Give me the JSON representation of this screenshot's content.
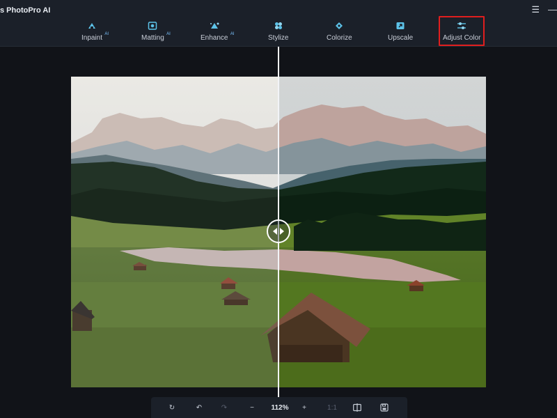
{
  "app": {
    "title": "s PhotoPro AI"
  },
  "window_controls": {
    "menu": "☰",
    "minimize": "—"
  },
  "toolbar": {
    "tools": [
      {
        "label": "Inpaint",
        "ai": "AI",
        "icon": "inpaint-icon"
      },
      {
        "label": "Matting",
        "ai": "AI",
        "icon": "matting-icon"
      },
      {
        "label": "Enhance",
        "ai": "AI",
        "icon": "enhance-icon"
      },
      {
        "label": "Stylize",
        "icon": "stylize-icon"
      },
      {
        "label": "Colorize",
        "icon": "colorize-icon"
      },
      {
        "label": "Upscale",
        "icon": "upscale-icon"
      },
      {
        "label": "Adjust Color",
        "icon": "adjust-color-icon",
        "active": true
      }
    ]
  },
  "comparison": {
    "handle_icon": "compare-handle-icon"
  },
  "bottom": {
    "reset": "↻",
    "undo": "↶",
    "redo": "↷",
    "zoom_out": "−",
    "zoom": "112%",
    "zoom_in": "+",
    "actual_size": "1:1"
  },
  "colors": {
    "accent_red": "#e01e1e",
    "ai_badge": "#7cc4ff",
    "bar_bg": "#1b2029",
    "canvas_bg": "#111318"
  }
}
